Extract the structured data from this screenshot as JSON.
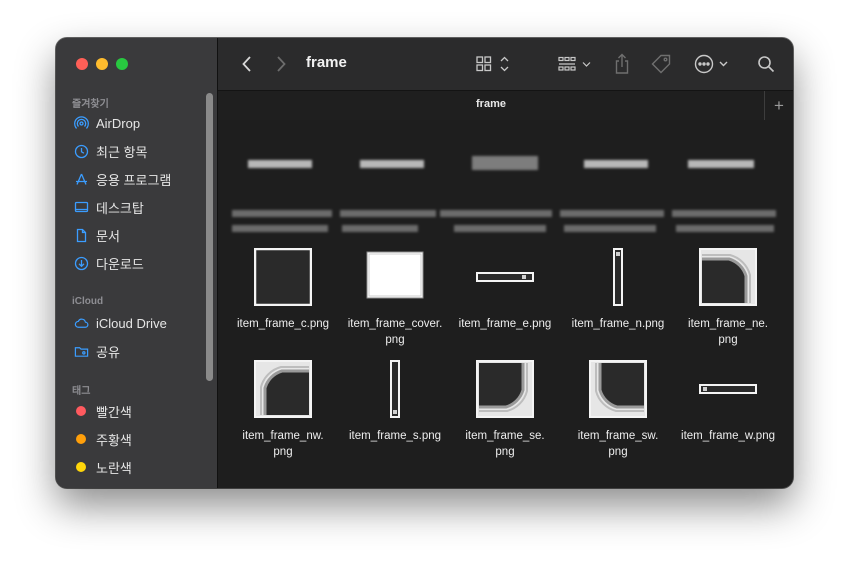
{
  "window": {
    "title": "frame",
    "tab_label": "frame"
  },
  "sidebar": {
    "favorites_header": "즐겨찾기",
    "favorites": [
      {
        "label": "AirDrop",
        "icon": "airdrop-icon"
      },
      {
        "label": "최근 항목",
        "icon": "clock-icon"
      },
      {
        "label": "응용 프로그램",
        "icon": "applications-icon"
      },
      {
        "label": "데스크탑",
        "icon": "desktop-icon"
      },
      {
        "label": "문서",
        "icon": "document-icon"
      },
      {
        "label": "다운로드",
        "icon": "download-icon"
      }
    ],
    "icloud_header": "iCloud",
    "icloud": [
      {
        "label": "iCloud Drive",
        "icon": "cloud-icon"
      },
      {
        "label": "공유",
        "icon": "shared-folder-icon"
      }
    ],
    "tags_header": "태그",
    "tags": [
      {
        "label": "빨간색",
        "color": "#ff5a5f"
      },
      {
        "label": "주황색",
        "color": "#ff9f0a"
      },
      {
        "label": "노란색",
        "color": "#ffd60a"
      }
    ]
  },
  "toolbar": {
    "new_tab": "+"
  },
  "files": [
    {
      "name": "item_frame_c.png"
    },
    {
      "name": "item_frame_cover.png"
    },
    {
      "name": "item_frame_e.png"
    },
    {
      "name": "item_frame_n.png"
    },
    {
      "name": "item_frame_ne.png"
    },
    {
      "name": "item_frame_nw.png"
    },
    {
      "name": "item_frame_s.png"
    },
    {
      "name": "item_frame_se.png"
    },
    {
      "name": "item_frame_sw.png"
    },
    {
      "name": "item_frame_w.png"
    }
  ],
  "colors": {
    "accent": "#3b9dff",
    "sidebar_bg": "#3a3a3c",
    "content_bg": "#1e1e1e"
  }
}
